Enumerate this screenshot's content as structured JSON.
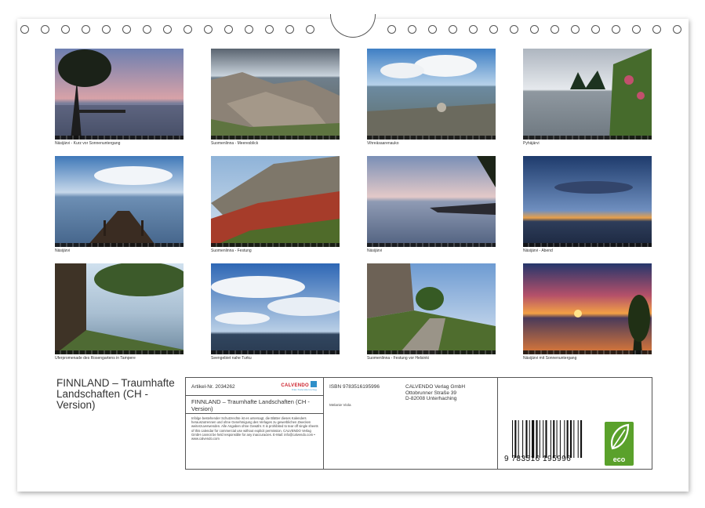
{
  "photos": [
    {
      "caption": "Näsijärvi - Kurz vor Sonnenuntergang"
    },
    {
      "caption": "Suomenlinna - Meeresblick"
    },
    {
      "caption": "Vihreäsaaren­auko"
    },
    {
      "caption": "Pyhäjärvi"
    },
    {
      "caption": "Näsijärvi"
    },
    {
      "caption": "Suomenlinna - Festung"
    },
    {
      "caption": "Näsijärvi"
    },
    {
      "caption": "Näsijärvi - Abend"
    },
    {
      "caption": "Uferpromenade des Rosengartens in Tampere"
    },
    {
      "caption": "Seengebiet nahe Turku"
    },
    {
      "caption": "Suomenlinna - Festung vor Helsinki"
    },
    {
      "caption": "Näsijärvi mit Sonnenuntergang"
    }
  ],
  "title": "FINNLAND – Traumhafte Landschaften (CH - Version)",
  "info": {
    "article_no": "Artikel-Nr. 2034262",
    "brand": "CALVENDO",
    "brand_sub": "Das Kalenderverlag",
    "title_small": "FINNLAND – Traumhafte Landschaften (CH - Version)",
    "legal": "Infolge bestehender Schutzrechte ist es untersagt, die Blätter dieses Kalenders herauszutrennen und ohne Genehmigung des Verlages zu gewerblichen Zwecken weiterzuverwenden. Alle Angaben ohne Gewähr. It is prohibited to tear off single sheets of this calendar for commercial use without explicit permission. CALVENDO Verlag GmbH cannot be held responsible for any inaccuracies. E-Mail: info@calvendo.com • www.calvendo.com",
    "isbn": "ISBN 9783516195996",
    "author": "Melanie Viola",
    "publisher_lines": [
      "CALVENDO Verlag GmbH",
      "Ottobrunner Straße 39",
      "D-82008 Unterhaching"
    ],
    "barcode_text": "9 783516 195996",
    "eco_label": "eco"
  },
  "colors": {
    "eco_green": "#5aa12b",
    "calvendo_red": "#cc1f2a"
  }
}
